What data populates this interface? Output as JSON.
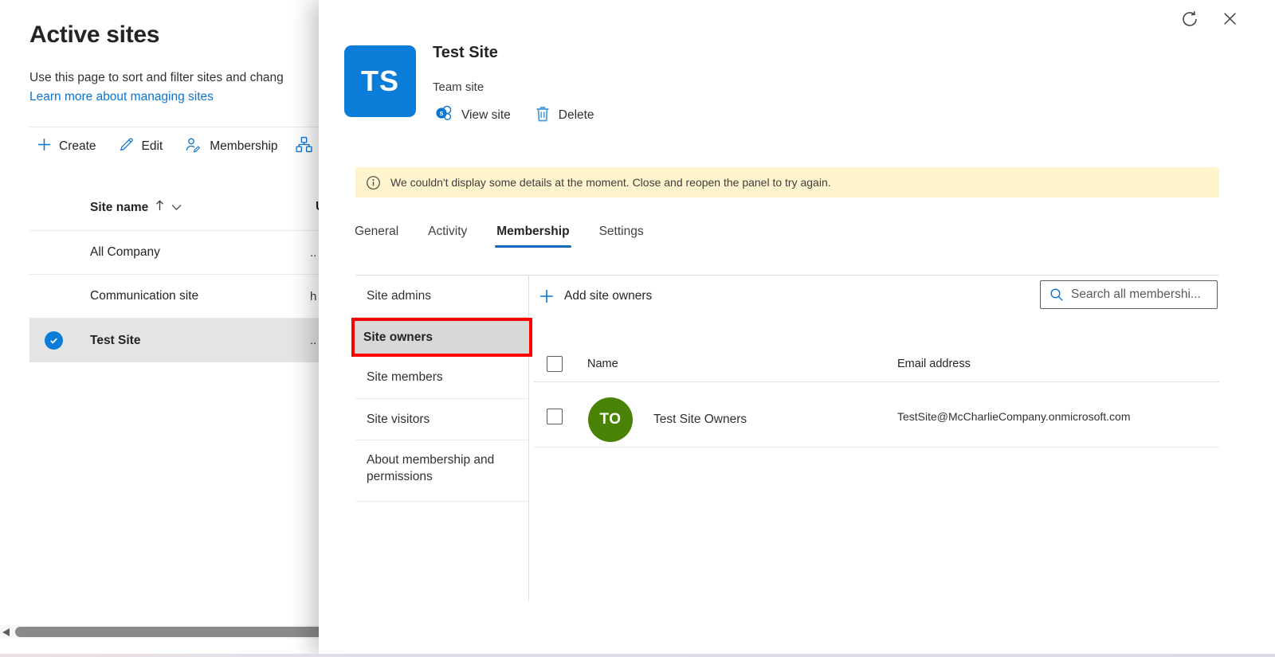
{
  "base_page": {
    "title": "Active sites",
    "description": "Use this page to sort and filter sites and chang",
    "learn_more": "Learn more about managing sites",
    "toolbar": {
      "create": "Create",
      "edit": "Edit",
      "membership": "Membership",
      "hub_icon": "hub-hierarchy-icon (partially hidden by panel)"
    },
    "table": {
      "site_name_header": "Site name",
      "sort_icons": [
        "ascending-arrow",
        "chevron-down"
      ],
      "url_header_partial": "U",
      "rows": [
        {
          "name": "All Company",
          "url_partial": "..",
          "selected": false
        },
        {
          "name": "Communication site",
          "url_partial": "h",
          "selected": false
        },
        {
          "name": "Test Site",
          "url_partial": "..",
          "selected": true
        }
      ]
    },
    "scrollbar": "horizontal"
  },
  "panel": {
    "window_controls": {
      "refresh": "refresh-icon",
      "close": "close-icon"
    },
    "header": {
      "initials": "TS",
      "title": "Test Site",
      "subtitle": "Team site",
      "view_site": "View site",
      "delete": "Delete"
    },
    "banner": {
      "icon": "info-icon",
      "text": "We couldn't display some details at the moment. Close and reopen the panel to try again."
    },
    "tabs": [
      {
        "label": "General",
        "active": false
      },
      {
        "label": "Activity",
        "active": false
      },
      {
        "label": "Membership",
        "active": true
      },
      {
        "label": "Settings",
        "active": false
      }
    ],
    "nav": [
      {
        "label": "Site admins",
        "selected": false
      },
      {
        "label": "Site owners",
        "selected": true,
        "annotation": "red highlight box"
      },
      {
        "label": "Site members",
        "selected": false
      },
      {
        "label": "Site visitors",
        "selected": false
      },
      {
        "label": "About membership and permissions",
        "selected": false
      }
    ],
    "content": {
      "add_button": "Add site owners",
      "search_placeholder": "Search all membershi...",
      "table": {
        "name_header": "Name",
        "email_header": "Email address",
        "rows": [
          {
            "initials": "TO",
            "name": "Test Site Owners",
            "email": "TestSite@McCharlieCompany.onmicrosoft.com"
          }
        ]
      }
    }
  },
  "colors": {
    "accent_blue": "#0b74d1",
    "tab_underline_blue": "#0f6cbd",
    "site_avatar_blue": "#0b7cd8",
    "member_avatar_green": "#498205",
    "banner_yellow": "#fff4ce",
    "annotation_red": "#fe0000",
    "selected_row_gray": "#e4e4e4",
    "nav_selected_gray": "#d8d8d8"
  }
}
